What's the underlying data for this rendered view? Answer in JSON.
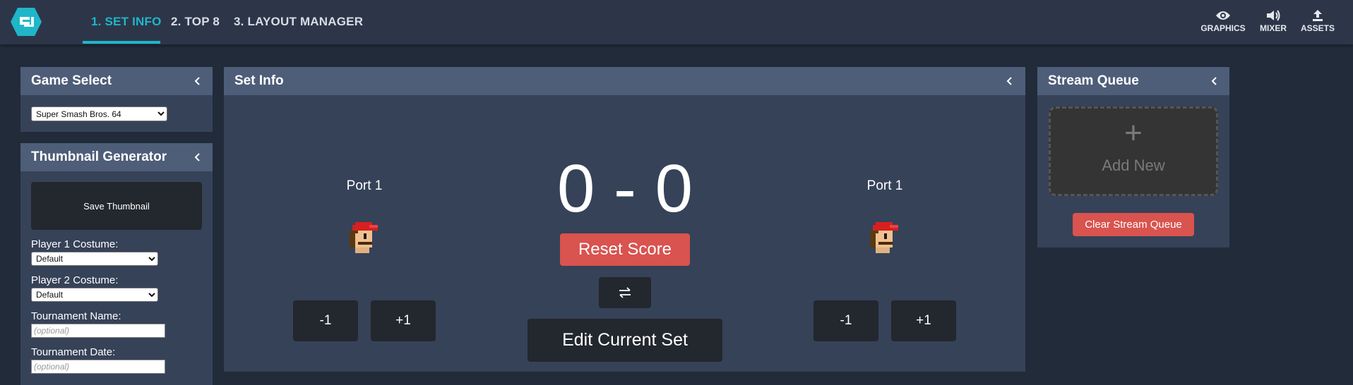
{
  "nav": {
    "tabs": [
      {
        "label": "1. SET INFO",
        "active": true
      },
      {
        "label": "2. TOP 8",
        "active": false
      },
      {
        "label": "3. LAYOUT MANAGER",
        "active": false
      }
    ],
    "actions": [
      {
        "label": "GRAPHICS",
        "icon": "eye-icon"
      },
      {
        "label": "MIXER",
        "icon": "speaker-icon"
      },
      {
        "label": "ASSETS",
        "icon": "upload-icon"
      }
    ],
    "accent_color": "#1fb6c9"
  },
  "game_select": {
    "title": "Game Select",
    "selected_game": "Super Smash Bros. 64"
  },
  "thumbnail_generator": {
    "title": "Thumbnail Generator",
    "save_label": "Save Thumbnail",
    "p1_costume_label": "Player 1 Costume:",
    "p1_costume_value": "Default",
    "p2_costume_label": "Player 2 Costume:",
    "p2_costume_value": "Default",
    "tournament_name_label": "Tournament Name:",
    "tournament_name_placeholder": "(optional)",
    "tournament_date_label": "Tournament Date:",
    "tournament_date_placeholder": "(optional)"
  },
  "set_info": {
    "title": "Set Info",
    "player1": {
      "port": "Port 1",
      "score": 0,
      "minus_label": "-1",
      "plus_label": "+1"
    },
    "player2": {
      "port": "Port 1",
      "score": 0,
      "minus_label": "-1",
      "plus_label": "+1"
    },
    "score_text": "0 - 0",
    "reset_label": "Reset Score",
    "swap_icon": "swap-arrows-icon",
    "edit_label": "Edit Current Set"
  },
  "stream_queue": {
    "title": "Stream Queue",
    "add_new_label": "Add New",
    "add_new_plus": "+",
    "clear_label": "Clear Stream Queue"
  }
}
